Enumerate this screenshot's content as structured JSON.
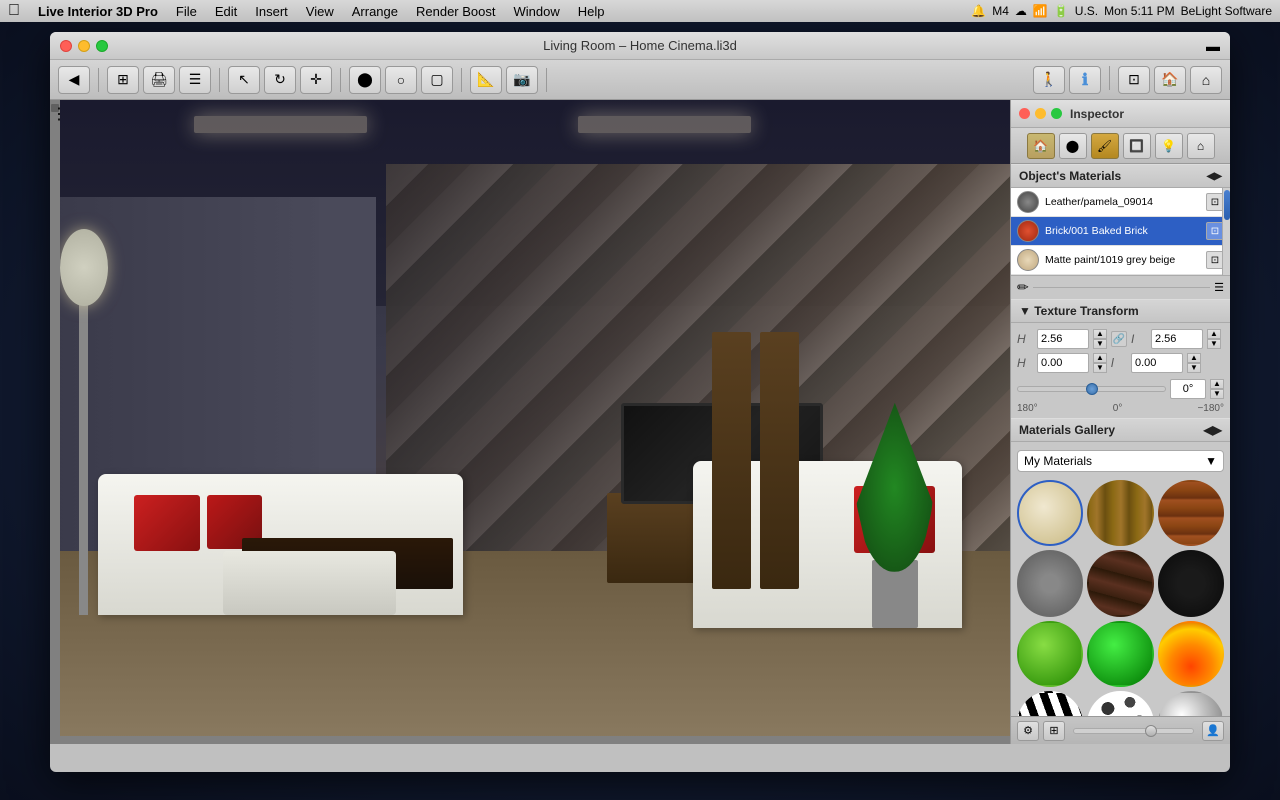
{
  "menubar": {
    "apple": "&#63743;",
    "items": [
      "Live Interior 3D Pro",
      "File",
      "Edit",
      "Insert",
      "View",
      "Arrange",
      "Render Boost",
      "Window",
      "Help"
    ],
    "right": {
      "status": "U.S.",
      "time": "Mon 5:11 PM",
      "company": "BeLight Software"
    }
  },
  "window": {
    "title": "Living Room – Home Cinema.li3d",
    "traffic_lights": [
      "close",
      "minimize",
      "maximize"
    ]
  },
  "inspector": {
    "title": "Inspector",
    "tabs": [
      "materials",
      "object",
      "paint",
      "texture",
      "light",
      "home"
    ],
    "objects_materials_label": "Object's Materials",
    "materials": [
      {
        "name": "Leather/pamela_09014",
        "color": "#5a5a5a",
        "selected": false
      },
      {
        "name": "Brick/001 Baked Brick",
        "color": "#c84020",
        "selected": true
      },
      {
        "name": "Matte paint/1019 grey beige",
        "color": "#d4c8b0",
        "selected": false
      }
    ],
    "texture_transform": {
      "label": "Texture Transform",
      "x_scale": "2.56",
      "y_scale": "2.56",
      "x_offset": "0.00",
      "y_offset": "0.00",
      "rotation_value": "0°",
      "rotation_min": "180°",
      "rotation_center": "0°",
      "rotation_max": "−180°"
    },
    "materials_gallery": {
      "label": "Materials Gallery",
      "dropdown_value": "My Materials",
      "items": [
        {
          "type": "cream",
          "label": "Cream fabric"
        },
        {
          "type": "wood1",
          "label": "Light wood"
        },
        {
          "type": "brick",
          "label": "Brick"
        },
        {
          "type": "concrete",
          "label": "Concrete"
        },
        {
          "type": "dark-wood",
          "label": "Dark wood"
        },
        {
          "type": "dark",
          "label": "Black material"
        },
        {
          "type": "green1",
          "label": "Green 1"
        },
        {
          "type": "green2",
          "label": "Green 2"
        },
        {
          "type": "fire",
          "label": "Fire"
        },
        {
          "type": "zebra",
          "label": "Zebra"
        },
        {
          "type": "spots",
          "label": "Spots"
        },
        {
          "type": "silver",
          "label": "Silver"
        }
      ]
    }
  }
}
